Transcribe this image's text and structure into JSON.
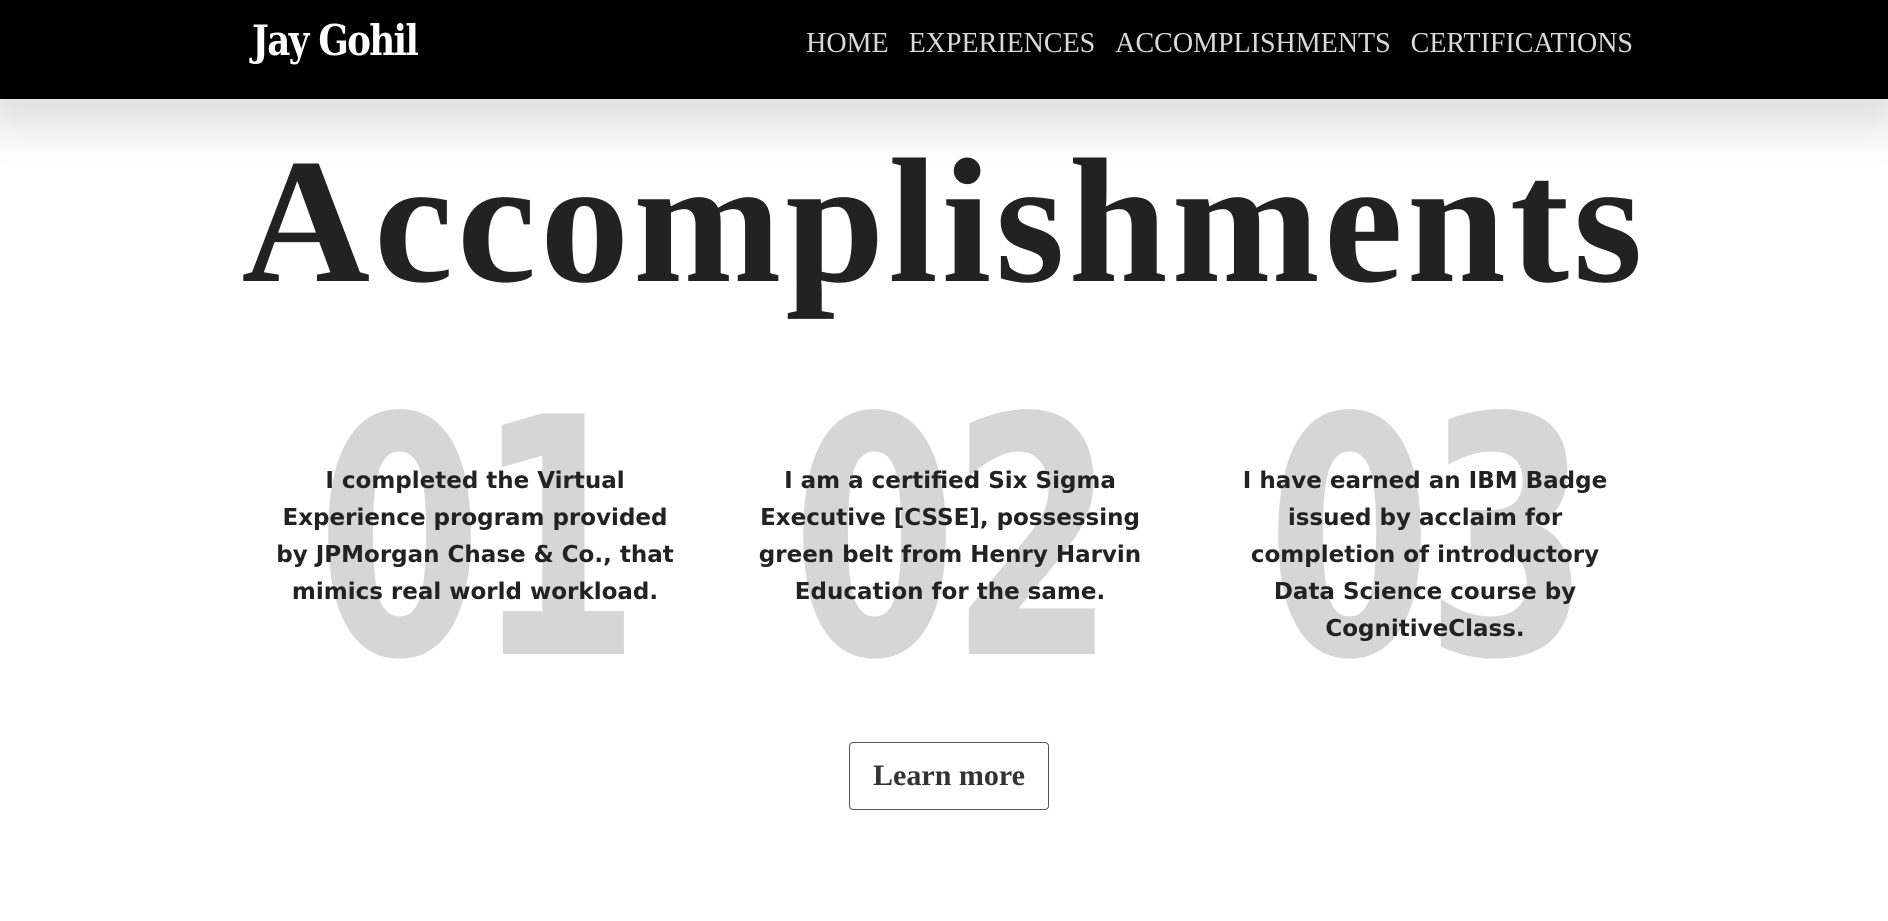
{
  "navbar": {
    "brand": "Jay Gohil",
    "links": [
      "HOME",
      "EXPERIENCES",
      "ACCOMPLISHMENTS",
      "CERTIFICATIONS"
    ]
  },
  "hero": {
    "title": "Accomplishments"
  },
  "items": [
    {
      "number": "01",
      "text": "I completed the Virtual Experience program provided by JPMorgan Chase & Co., that mimics real world workload."
    },
    {
      "number": "02",
      "text": "I am a certified Six Sigma Executive [CSSE], possessing green belt from Henry Harvin Education for the same."
    },
    {
      "number": "03",
      "text": "I have earned an IBM Badge issued by acclaim for completion of introductory Data Science course by CognitiveClass."
    }
  ],
  "cta": {
    "label": "Learn more"
  }
}
